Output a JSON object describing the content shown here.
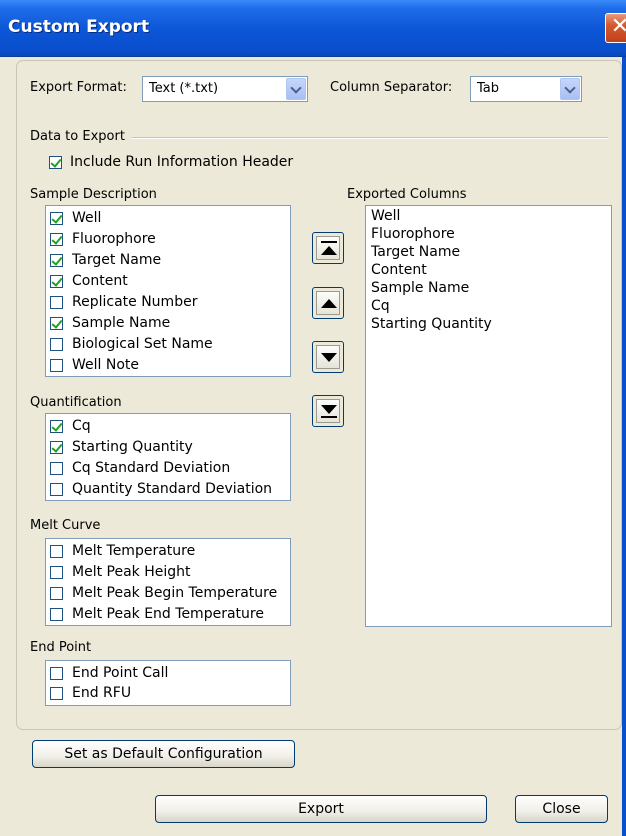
{
  "window": {
    "title": "Custom Export",
    "close_label": "✕"
  },
  "export_format": {
    "label": "Export Format:",
    "value": "Text (*.txt)"
  },
  "column_separator": {
    "label": "Column Separator:",
    "value": "Tab"
  },
  "data_to_export": {
    "heading": "Data to Export",
    "include_header": {
      "label": "Include Run Information Header",
      "checked": true
    }
  },
  "sample_description": {
    "heading": "Sample Description",
    "items": [
      {
        "label": "Well",
        "checked": true
      },
      {
        "label": "Fluorophore",
        "checked": true
      },
      {
        "label": "Target Name",
        "checked": true
      },
      {
        "label": "Content",
        "checked": true
      },
      {
        "label": "Replicate Number",
        "checked": false
      },
      {
        "label": "Sample Name",
        "checked": true
      },
      {
        "label": "Biological Set Name",
        "checked": false
      },
      {
        "label": "Well Note",
        "checked": false
      }
    ]
  },
  "quantification": {
    "heading": "Quantification",
    "items": [
      {
        "label": "Cq",
        "checked": true
      },
      {
        "label": "Starting Quantity",
        "checked": true
      },
      {
        "label": "Cq Standard Deviation",
        "checked": false
      },
      {
        "label": "Quantity Standard Deviation",
        "checked": false
      }
    ]
  },
  "melt_curve": {
    "heading": "Melt Curve",
    "items": [
      {
        "label": "Melt Temperature",
        "checked": false
      },
      {
        "label": "Melt Peak Height",
        "checked": false
      },
      {
        "label": "Melt Peak Begin Temperature",
        "checked": false
      },
      {
        "label": "Melt Peak End Temperature",
        "checked": false
      }
    ]
  },
  "end_point": {
    "heading": "End Point",
    "items": [
      {
        "label": "End Point Call",
        "checked": false
      },
      {
        "label": "End RFU",
        "checked": false
      }
    ]
  },
  "exported_columns": {
    "heading": "Exported Columns",
    "items": [
      "Well",
      "Fluorophore",
      "Target Name",
      "Content",
      "Sample Name",
      "Cq",
      "Starting Quantity"
    ]
  },
  "buttons": {
    "set_default": "Set as Default Configuration",
    "export": "Export",
    "close": "Close"
  },
  "icons": [
    "move-to-top-icon",
    "move-up-icon",
    "move-down-icon",
    "move-to-bottom-icon",
    "close-icon",
    "checkmark-icon",
    "dropdown-arrow-icon"
  ],
  "colors": {
    "titlebar": "#0a55d6",
    "dialog_bg": "#ece9d8",
    "check": "#21a121",
    "close_button": "#d35a2f"
  }
}
